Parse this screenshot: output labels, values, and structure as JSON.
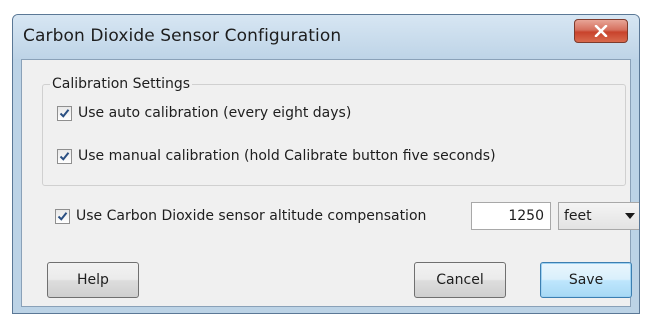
{
  "window": {
    "title": "Carbon Dioxide Sensor Configuration"
  },
  "calibration": {
    "group_label": "Calibration Settings",
    "auto": {
      "label": "Use auto calibration (every eight days)",
      "checked": true
    },
    "manual": {
      "label": "Use manual calibration (hold Calibrate button five seconds)",
      "checked": true
    }
  },
  "altitude": {
    "label": "Use Carbon Dioxide sensor altitude compensation",
    "checked": true,
    "value": "1250",
    "unit": "feet"
  },
  "buttons": {
    "help": "Help",
    "cancel": "Cancel",
    "save": "Save"
  },
  "colors": {
    "close_button": "#c8432c",
    "checkmark": "#2a4f82",
    "default_button_border": "#3c7fb1"
  }
}
